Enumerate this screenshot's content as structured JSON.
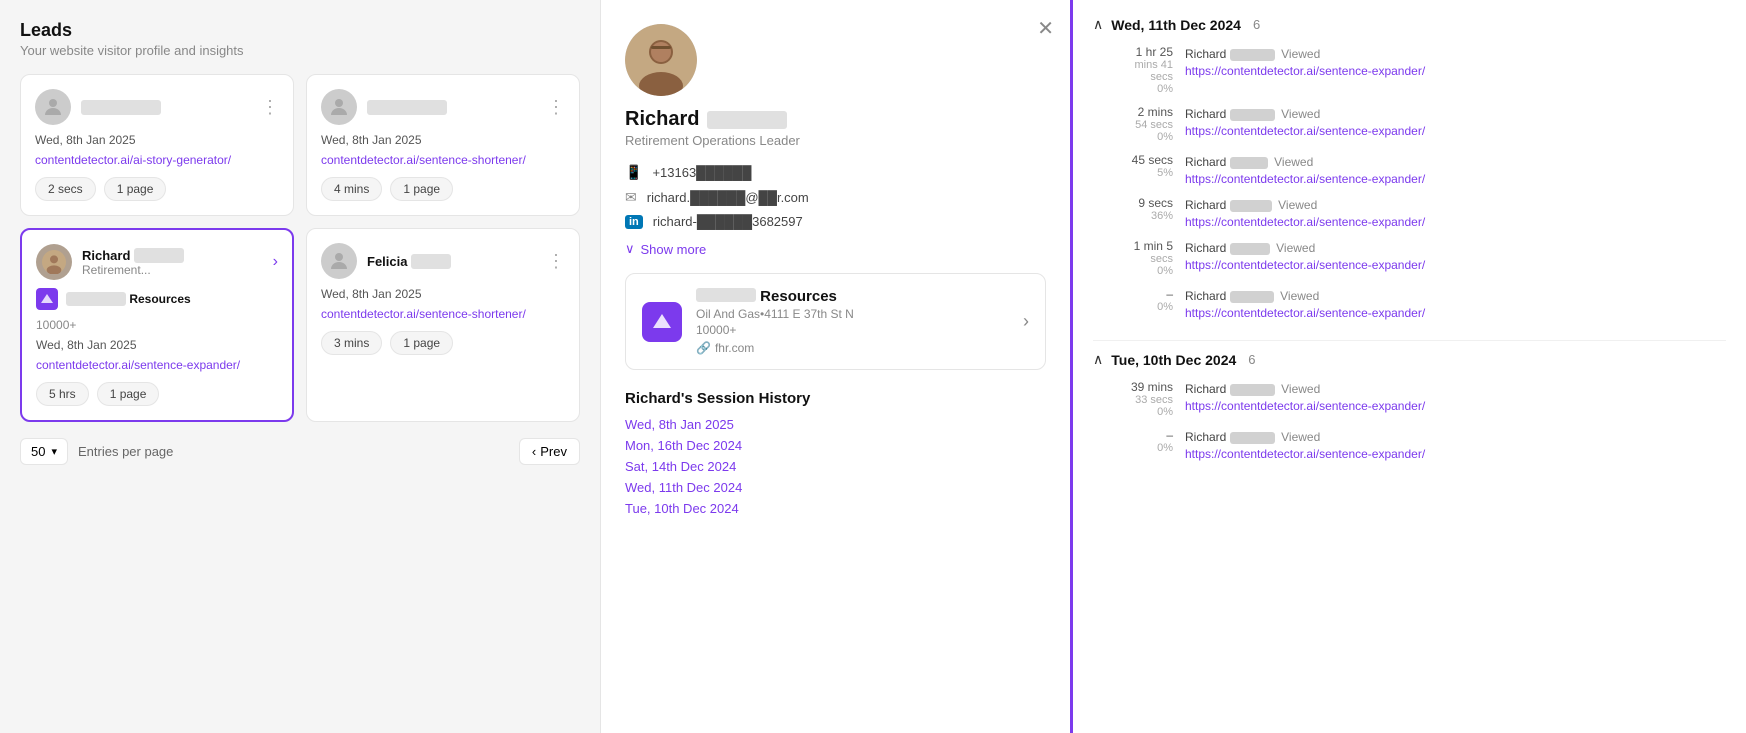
{
  "leads": {
    "title": "Leads",
    "subtitle": "Your website visitor profile and insights"
  },
  "cards": [
    {
      "id": "card-1",
      "avatar_type": "gray",
      "name_blur": true,
      "date": "Wed, 8th Jan 2025",
      "link": "contentdetector.ai/ai-story-generator/",
      "time_stat": "2 secs",
      "page_stat": "1 page",
      "active": false
    },
    {
      "id": "card-2",
      "avatar_type": "gray",
      "name_blur": true,
      "date": "Wed, 8th Jan 2025",
      "link": "contentdetector.ai/sentence-shortener/",
      "time_stat": "4 mins",
      "page_stat": "1 page",
      "active": false
    },
    {
      "id": "card-richard",
      "avatar_type": "photo",
      "name": "Richard",
      "name_blurred_part": true,
      "role": "Retirement...",
      "company": "Resources",
      "company_blurred": true,
      "company_employees": "10000+",
      "date": "Wed, 8th Jan 2025",
      "link": "contentdetector.ai/sentence-expander/",
      "time_stat": "5 hrs",
      "page_stat": "1 page",
      "active": true
    },
    {
      "id": "card-felicia",
      "avatar_type": "gray",
      "name": "Felicia",
      "name_blurred_part": true,
      "date": "Wed, 8th Jan 2025",
      "link": "contentdetector.ai/sentence-shortener/",
      "time_stat": "3 mins",
      "page_stat": "1 page",
      "active": false
    }
  ],
  "pagination": {
    "per_page": "50",
    "label": "Entries per page",
    "prev_label": "Prev"
  },
  "profile": {
    "name": "Richard",
    "role": "Retirement Operations Leader",
    "phone": "+13163██████",
    "email": "richard.██████@██r.com",
    "linkedin": "richard-██████3682597",
    "company_name": "Resources",
    "company_sub": "Oil And Gas•4111 E 37th St N",
    "company_employees": "10000+",
    "company_url": "fhr.com",
    "show_more": "Show more",
    "session_history_title": "Richard's Session History",
    "session_dates": [
      "Wed, 8th Jan 2025",
      "Mon, 16th Dec 2024",
      "Sat, 14th Dec 2024",
      "Wed, 11th Dec 2024",
      "Tue, 10th Dec 2024"
    ]
  },
  "activity": {
    "days": [
      {
        "date": "Wed, 11th Dec 2024",
        "count": 6,
        "collapsed": false,
        "entries": [
          {
            "time_main": "1 hr 25",
            "time_sub": "mins 41",
            "time_sub2": "secs",
            "pct": "0%",
            "actor": "Richard",
            "action": "Viewed",
            "link": "https://contentdetector.ai/sentence-expander/"
          },
          {
            "time_main": "2 mins",
            "time_sub": "54 secs",
            "pct": "0%",
            "actor": "Richard",
            "action": "Viewed",
            "link": "https://contentdetector.ai/sentence-expander/"
          },
          {
            "time_main": "45 secs",
            "pct": "5%",
            "actor": "Richard",
            "action": "Viewed",
            "link": "https://contentdetector.ai/sentence-expander/"
          },
          {
            "time_main": "9 secs",
            "pct": "36%",
            "actor": "Richard",
            "action": "Viewed",
            "link": "https://contentdetector.ai/sentence-expander/"
          },
          {
            "time_main": "1 min 5",
            "time_sub": "secs",
            "pct": "0%",
            "actor": "Richard",
            "action": "Viewed",
            "link": "https://contentdetector.ai/sentence-expander/"
          },
          {
            "time_main": "–",
            "pct": "0%",
            "actor": "Richard",
            "action": "Viewed",
            "link": "https://contentdetector.ai/sentence-expander/"
          }
        ]
      },
      {
        "date": "Tue, 10th Dec 2024",
        "count": 6,
        "collapsed": false,
        "entries": [
          {
            "time_main": "39 mins",
            "time_sub": "33 secs",
            "pct": "0%",
            "actor": "Richard",
            "action": "Viewed",
            "link": "https://contentdetector.ai/sentence-expander/"
          },
          {
            "time_main": "–",
            "pct": "0%",
            "actor": "Richard",
            "action": "Viewed",
            "link": "https://contentdetector.ai/sentence-expander/"
          }
        ]
      }
    ]
  },
  "icons": {
    "close": "✕",
    "chevron_right": "›",
    "chevron_down": "∨",
    "chevron_left": "‹",
    "phone": "📞",
    "email": "✉",
    "linkedin": "in",
    "link": "🔗",
    "arrow_up": "∧"
  }
}
